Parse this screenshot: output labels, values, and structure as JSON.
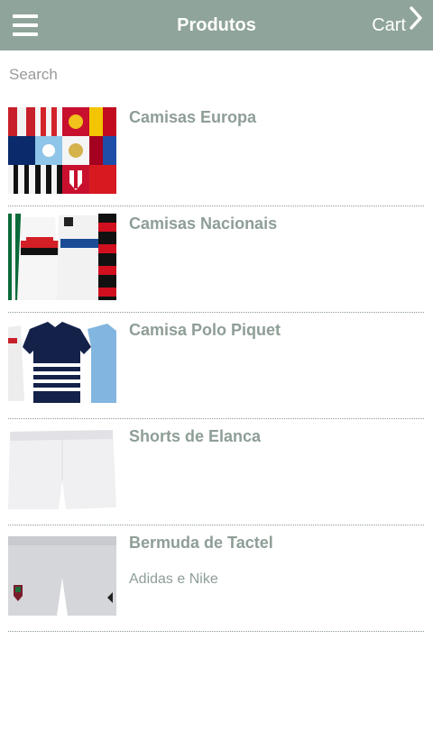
{
  "header": {
    "title": "Produtos",
    "cart_label": "Cart"
  },
  "search": {
    "placeholder": "Search"
  },
  "products": [
    {
      "title": "Camisas Europa",
      "subtitle": ""
    },
    {
      "title": "Camisas Nacionais",
      "subtitle": ""
    },
    {
      "title": "Camisa Polo Piquet",
      "subtitle": ""
    },
    {
      "title": "Shorts de Elanca",
      "subtitle": ""
    },
    {
      "title": "Bermuda de Tactel",
      "subtitle": "Adidas e Nike"
    }
  ],
  "colors": {
    "header_bg": "#8fa49a",
    "item_text": "#8e9e96"
  }
}
